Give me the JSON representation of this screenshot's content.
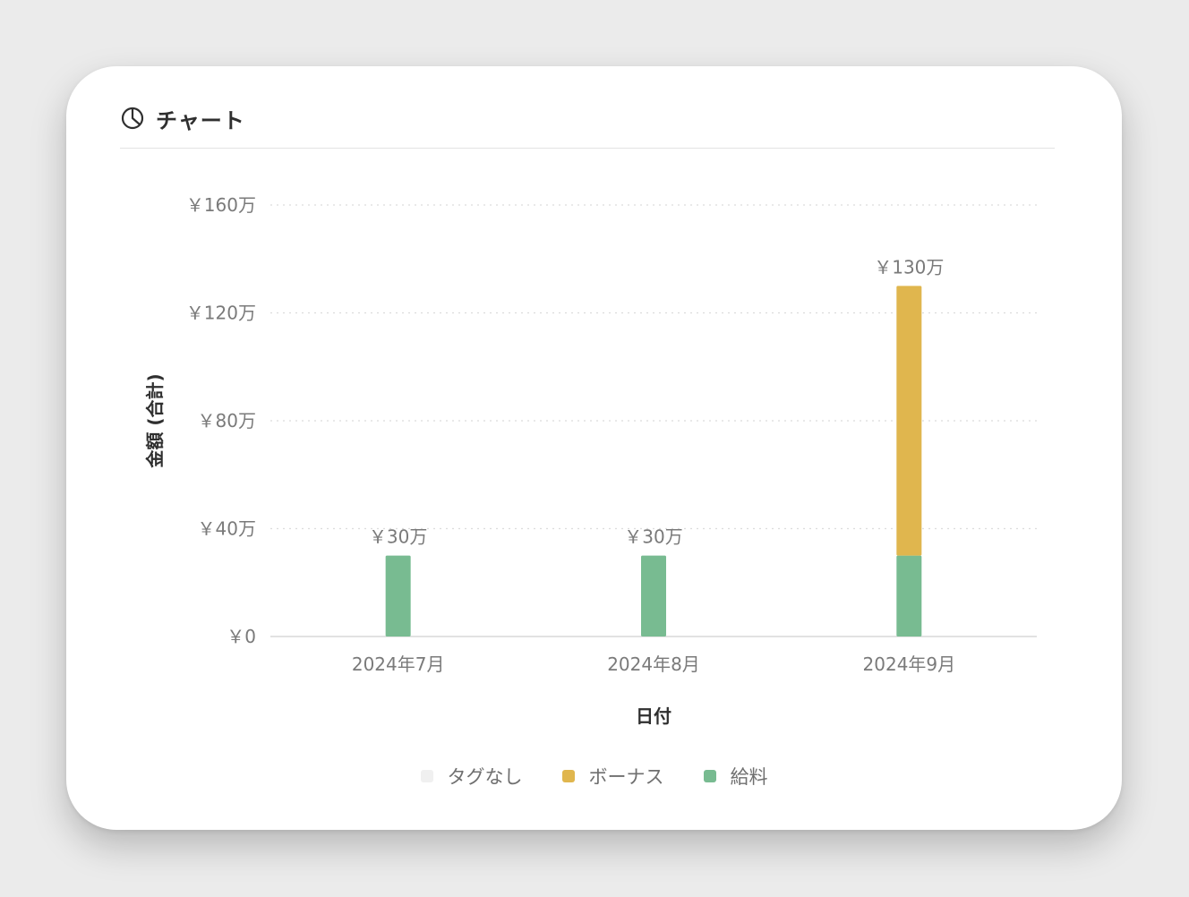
{
  "card": {
    "title": "チャート",
    "icon": "pie-chart-icon"
  },
  "colors": {
    "none": "#f0f0f0",
    "bonus": "#e0b64e",
    "salary": "#78bb91",
    "grid": "#dcdcdc",
    "axis": "#e2e2e2",
    "tick_text": "#7a7a7a",
    "title_text": "#2f2f2f"
  },
  "legend": [
    {
      "label": "タグなし",
      "color": "#f0f0f0"
    },
    {
      "label": "ボーナス",
      "color": "#e0b64e"
    },
    {
      "label": "給料",
      "color": "#78bb91"
    }
  ],
  "chart_data": {
    "type": "bar",
    "stacked": true,
    "categories": [
      "2024年7月",
      "2024年8月",
      "2024年9月"
    ],
    "series": [
      {
        "name": "タグなし",
        "values": [
          0,
          0,
          0
        ]
      },
      {
        "name": "給料",
        "values": [
          300000,
          300000,
          300000
        ]
      },
      {
        "name": "ボーナス",
        "values": [
          0,
          0,
          1000000
        ]
      }
    ],
    "totals": [
      300000,
      300000,
      1300000
    ],
    "total_labels": [
      "￥30万",
      "￥30万",
      "￥130万"
    ],
    "xlabel": "日付",
    "ylabel": "金額 (合計)",
    "ylim": [
      0,
      1600000
    ],
    "yticks": [
      0,
      400000,
      800000,
      1200000,
      1600000
    ],
    "ytick_labels": [
      "￥0",
      "￥40万",
      "￥80万",
      "￥120万",
      "￥160万"
    ],
    "grid": true,
    "legend_position": "bottom"
  }
}
